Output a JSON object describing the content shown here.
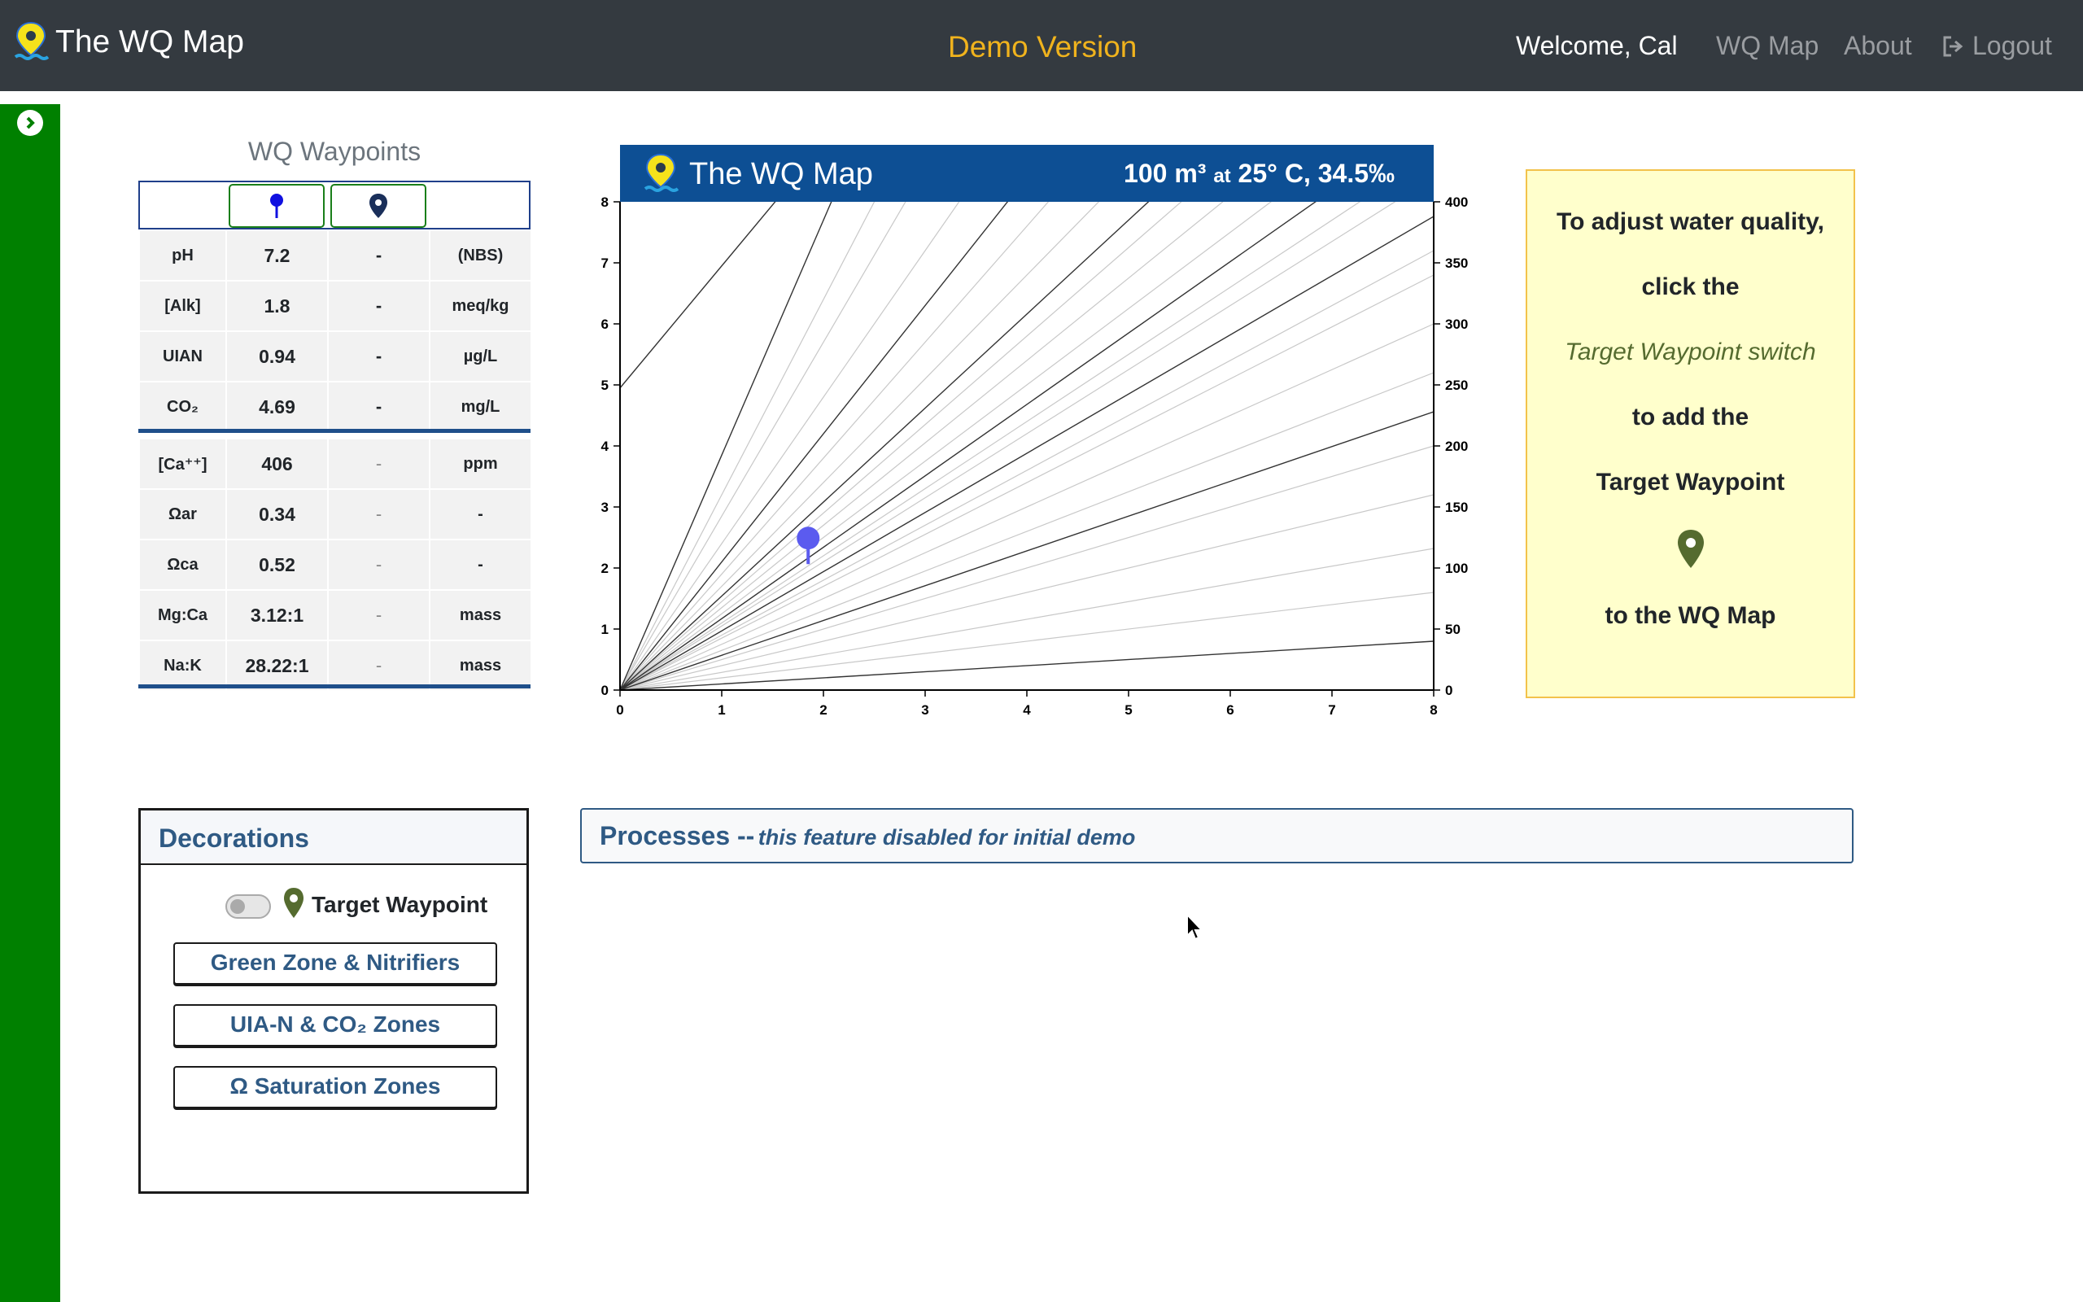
{
  "navbar": {
    "brand": "The WQ Map",
    "demo_label": "Demo Version",
    "welcome": "Welcome, Cal",
    "links": [
      "WQ Map",
      "About",
      "Logout"
    ]
  },
  "sidebar": {
    "toggle_icon": "chevron-right-circle-icon",
    "color": "#008000"
  },
  "waypoints": {
    "title": "WQ Waypoints",
    "rows": [
      {
        "label": "pH",
        "value": "7.2",
        "target": "-",
        "unit": "(NBS)"
      },
      {
        "label": "[Alk]",
        "value": "1.8",
        "target": "-",
        "unit": "meq/kg"
      },
      {
        "label": "UIAN",
        "value": "0.94",
        "target": "-",
        "unit": "µg/L"
      },
      {
        "label": "CO₂",
        "value": "4.69",
        "target": "-",
        "unit": "mg/L"
      },
      {
        "label": "[Ca⁺⁺]",
        "value": "406",
        "target": "-",
        "unit": "ppm"
      },
      {
        "label": "Ωar",
        "value": "0.34",
        "target": "-",
        "unit": "-"
      },
      {
        "label": "Ωca",
        "value": "0.52",
        "target": "-",
        "unit": "-"
      },
      {
        "label": "Mg:Ca",
        "value": "3.12:1",
        "target": "-",
        "unit": "mass"
      },
      {
        "label": "Na:K",
        "value": "28.22:1",
        "target": "-",
        "unit": "mass"
      }
    ]
  },
  "chart": {
    "title": "The WQ Map",
    "conditions_main": "100 m³",
    "conditions_small": "at",
    "conditions_rest": "25° C, 34.5‰",
    "left_ticks": [
      "0",
      "1",
      "2",
      "3",
      "4",
      "5",
      "6",
      "7",
      "8"
    ],
    "right_ticks": [
      "0",
      "50",
      "100",
      "150",
      "200",
      "250",
      "300",
      "350",
      "400"
    ],
    "bottom_ticks": [
      "0",
      "1",
      "2",
      "3",
      "4",
      "5",
      "6",
      "7",
      "8"
    ]
  },
  "chart_data": {
    "type": "scatter",
    "xlim": [
      0,
      8
    ],
    "ylim": [
      0,
      8
    ],
    "y2lim": [
      0,
      400
    ],
    "grid": false,
    "points": [
      {
        "x": 1.85,
        "y": 2.25
      }
    ],
    "point_color": "#5b5bef",
    "dark_line_slopes": [
      0.1,
      0.57,
      0.97,
      1.17,
      1.54,
      2.1,
      3.85
    ],
    "light_line_slopes": [
      0.2,
      0.29,
      0.4,
      0.5,
      0.65,
      0.75,
      0.85,
      0.9,
      1.05,
      1.1,
      1.25,
      1.35,
      1.45,
      1.7,
      1.9,
      2.4,
      2.85,
      3.2
    ],
    "offset_line": {
      "y0": 4.95,
      "slope": 2.0
    }
  },
  "info": {
    "lines": [
      "To adjust water quality,",
      "click the",
      "Target Waypoint switch",
      "to add the",
      "Target Waypoint",
      "to the WQ Map"
    ],
    "pin_color": "#556b2f"
  },
  "decorations": {
    "title": "Decorations",
    "toggle_label": "Target Waypoint",
    "buttons": [
      "Green Zone & Nitrifiers",
      "UIA-N & CO₂ Zones",
      "Ω Saturation Zones"
    ]
  },
  "processes": {
    "title": "Processes --",
    "note": "this feature disabled for initial demo"
  }
}
